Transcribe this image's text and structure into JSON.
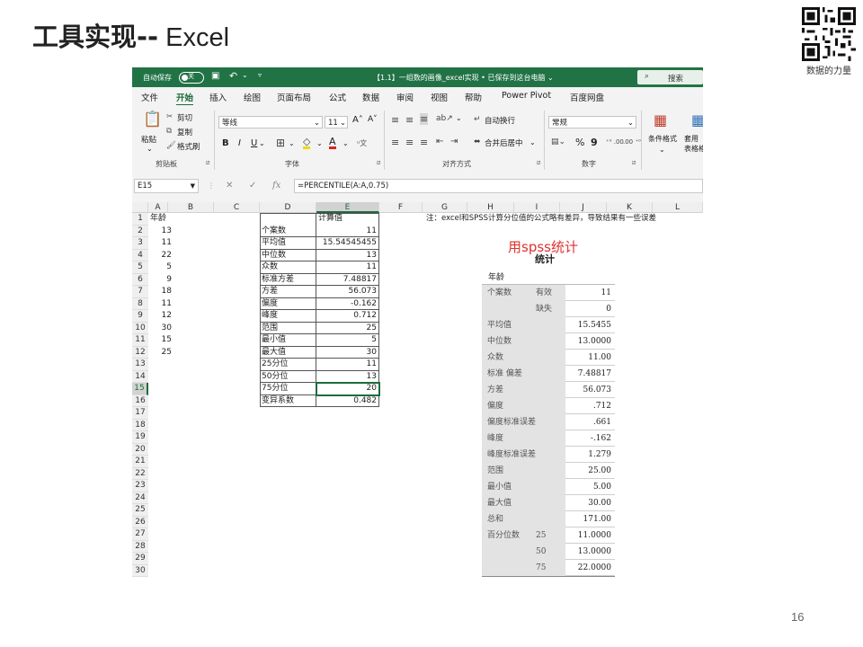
{
  "slide": {
    "title_cjk": "工具实现--",
    "title_en": " Excel",
    "qr_caption": "数据的力量",
    "page_number": "16"
  },
  "excel": {
    "titlebar": {
      "autosave": "自动保存",
      "autosave_state": "关",
      "undo_icon": "undo-icon",
      "document_title": "【1.1】一组数的画像_excel实现 • 已保存到这台电脑 ⌄",
      "search": "搜索"
    },
    "tabs": [
      "文件",
      "开始",
      "插入",
      "绘图",
      "页面布局",
      "公式",
      "数据",
      "审阅",
      "视图",
      "帮助",
      "Power Pivot",
      "百度网盘"
    ],
    "active_tab": "开始",
    "ribbon": {
      "paste": "粘贴",
      "cut": "剪切",
      "copy": "复制",
      "format_painter": "格式刷",
      "clipboard_group": "剪贴板",
      "font_name": "等线",
      "font_size": "11",
      "bold": "B",
      "italic": "I",
      "underline": "U",
      "font_group": "字体",
      "wrap_text": "自动换行",
      "merge_center": "合并后居中",
      "alignment_group": "对齐方式",
      "number_format": "常规",
      "percent": "%",
      "comma": "9",
      "number_group": "数字",
      "conditional_format": "条件格式",
      "format_as_table": "套用\n表格格"
    },
    "formula_bar": {
      "cell_ref": "E15",
      "fx": "fx",
      "formula": "=PERCENTILE(A:A,0.75)"
    },
    "columns": [
      "A",
      "B",
      "C",
      "D",
      "E",
      "F",
      "G",
      "H",
      "I",
      "J",
      "K",
      "L"
    ],
    "rows": [
      "1",
      "2",
      "3",
      "4",
      "5",
      "6",
      "7",
      "8",
      "9",
      "10",
      "11",
      "12",
      "13",
      "14",
      "15",
      "16",
      "17",
      "18",
      "19",
      "20",
      "21",
      "22",
      "23",
      "24",
      "25",
      "26",
      "27",
      "28",
      "29",
      "30"
    ],
    "col_a": [
      "年龄",
      "13",
      "11",
      "22",
      "5",
      "9",
      "18",
      "11",
      "12",
      "30",
      "15",
      "25"
    ],
    "stats_header": "计算值",
    "stats": [
      {
        "label": "个案数",
        "value": "11"
      },
      {
        "label": "平均值",
        "value": "15.54545455"
      },
      {
        "label": "中位数",
        "value": "13"
      },
      {
        "label": "众数",
        "value": "11"
      },
      {
        "label": "标准方差",
        "value": "7.48817"
      },
      {
        "label": "方差",
        "value": "56.073"
      },
      {
        "label": "偏度",
        "value": "-0.162"
      },
      {
        "label": "峰度",
        "value": "0.712"
      },
      {
        "label": "范围",
        "value": "25"
      },
      {
        "label": "最小值",
        "value": "5"
      },
      {
        "label": "最大值",
        "value": "30"
      },
      {
        "label": "25分位",
        "value": "11"
      },
      {
        "label": "50分位",
        "value": "13"
      },
      {
        "label": "75分位",
        "value": "20"
      },
      {
        "label": "变异系数",
        "value": "0.482"
      }
    ],
    "note": "注：excel和SPSS计算分位值的公式略有差异，导致结果有一些误差",
    "spss": {
      "annotation": "用spss统计",
      "title": "统计",
      "variable": "年龄",
      "rows": [
        {
          "label": "个案数",
          "sub": "有效",
          "value": "11"
        },
        {
          "label": "",
          "sub": "缺失",
          "value": "0"
        },
        {
          "label": "平均值",
          "sub": "",
          "value": "15.5455"
        },
        {
          "label": "中位数",
          "sub": "",
          "value": "13.0000"
        },
        {
          "label": "众数",
          "sub": "",
          "value": "11.00"
        },
        {
          "label": "标准 偏差",
          "sub": "",
          "value": "7.48817"
        },
        {
          "label": "方差",
          "sub": "",
          "value": "56.073"
        },
        {
          "label": "偏度",
          "sub": "",
          "value": ".712"
        },
        {
          "label": "偏度标准误差",
          "sub": "",
          "value": ".661"
        },
        {
          "label": "峰度",
          "sub": "",
          "value": "-.162"
        },
        {
          "label": "峰度标准误差",
          "sub": "",
          "value": "1.279"
        },
        {
          "label": "范围",
          "sub": "",
          "value": "25.00"
        },
        {
          "label": "最小值",
          "sub": "",
          "value": "5.00"
        },
        {
          "label": "最大值",
          "sub": "",
          "value": "30.00"
        },
        {
          "label": "总和",
          "sub": "",
          "value": "171.00"
        },
        {
          "label": "百分位数",
          "sub": "25",
          "value": "11.0000"
        },
        {
          "label": "",
          "sub": "50",
          "value": "13.0000"
        },
        {
          "label": "",
          "sub": "75",
          "value": "22.0000"
        }
      ]
    },
    "colors": {
      "excel_green": "#217346",
      "selection": "#1e6b3c",
      "spss_label_bg": "#e3e3e3",
      "annotation": "#e03030"
    }
  }
}
